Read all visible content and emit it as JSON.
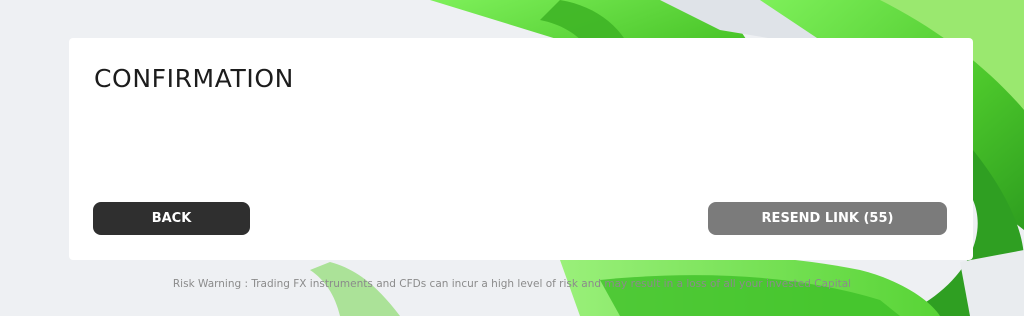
{
  "dialog": {
    "title": "CONFIRMATION",
    "back_label": "BACK",
    "resend_label": "RESEND LINK (55)"
  },
  "footer": {
    "risk_warning": "Risk Warning : Trading FX instruments and CFDs can incur a high level of risk and may result in a loss of all your invested Capital"
  },
  "colors": {
    "background": "#eef0f3",
    "accent_green": "#5fd23b",
    "back_button": "#2f2f2f",
    "resend_button": "#7b7b7b"
  }
}
